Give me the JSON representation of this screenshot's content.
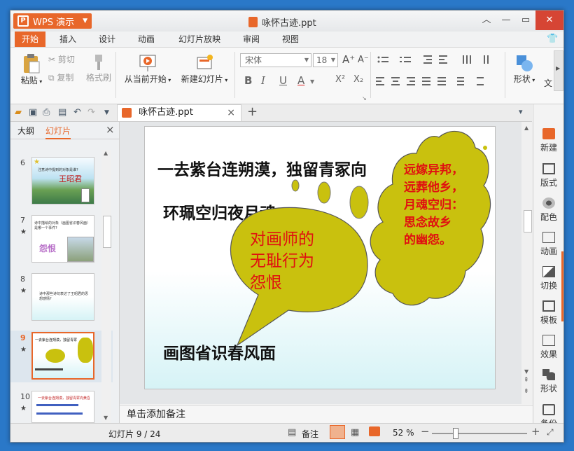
{
  "app": {
    "name": "WPS 演示",
    "document_title": "咏怀古迹.ppt"
  },
  "menu": {
    "tabs": [
      "开始",
      "插入",
      "设计",
      "动画",
      "幻灯片放映",
      "审阅",
      "视图"
    ],
    "active": "开始"
  },
  "ribbon": {
    "paste": "粘贴",
    "cut": "剪切",
    "copy": "复制",
    "format_painter": "格式刷",
    "from_current": "从当前开始",
    "new_slide": "新建幻灯片",
    "font_name": "宋体",
    "font_size": "18",
    "bold": "B",
    "italic": "I",
    "underline": "U",
    "font_color": "A",
    "superscript": "X²",
    "subscript": "X₂",
    "grow_font": "A⁺",
    "shrink_font": "A⁻",
    "shape": "形状",
    "text_more": "文"
  },
  "tab": {
    "name": "咏怀古迹.ppt",
    "close": "×",
    "add": "+"
  },
  "left_panel": {
    "tabs": [
      "大纲",
      "幻灯片"
    ],
    "active_tab": "幻灯片",
    "close": "×",
    "slides": [
      {
        "number": "6",
        "title": "王昭君",
        "caption": "注意诗中提到的对象是谁?"
      },
      {
        "number": "7",
        "title": "怨恨",
        "caption": "诗中描绘的对象（画图省识春风面）是哪一个事件?"
      },
      {
        "number": "8",
        "caption": "诗中那些诗句表达了王昭君的思想感情?"
      },
      {
        "number": "9",
        "selected": true,
        "caption": "一去紫台连朔漠，独留青冢向黄昏"
      },
      {
        "number": "10",
        "caption": "一去紫台连朔漠，独留青冢向黄昏"
      }
    ]
  },
  "slide": {
    "line1": "一去紫台连朔漠，独留青冢向",
    "line2": "环珮空归夜月魂",
    "line3": "画图省识春风面",
    "callout_left": [
      "对画师的",
      "无耻行为",
      "怨恨"
    ],
    "callout_right": [
      "远嫁异邦，",
      "远葬他乡，",
      "月魂空归：",
      "思念故乡",
      "的幽怨。"
    ]
  },
  "notes_placeholder": "单击添加备注",
  "right_panel": [
    "新建",
    "版式",
    "配色",
    "动画",
    "切换",
    "模板",
    "效果",
    "形状",
    "备份"
  ],
  "status": {
    "slide_indicator": "幻灯片 9 / 24",
    "notes": "备注",
    "zoom": "52 %",
    "minus": "−",
    "plus": "+"
  },
  "colors": {
    "accent": "#e8672a",
    "callout_fill": "#c9c10e",
    "callout_text": "#e01010"
  }
}
